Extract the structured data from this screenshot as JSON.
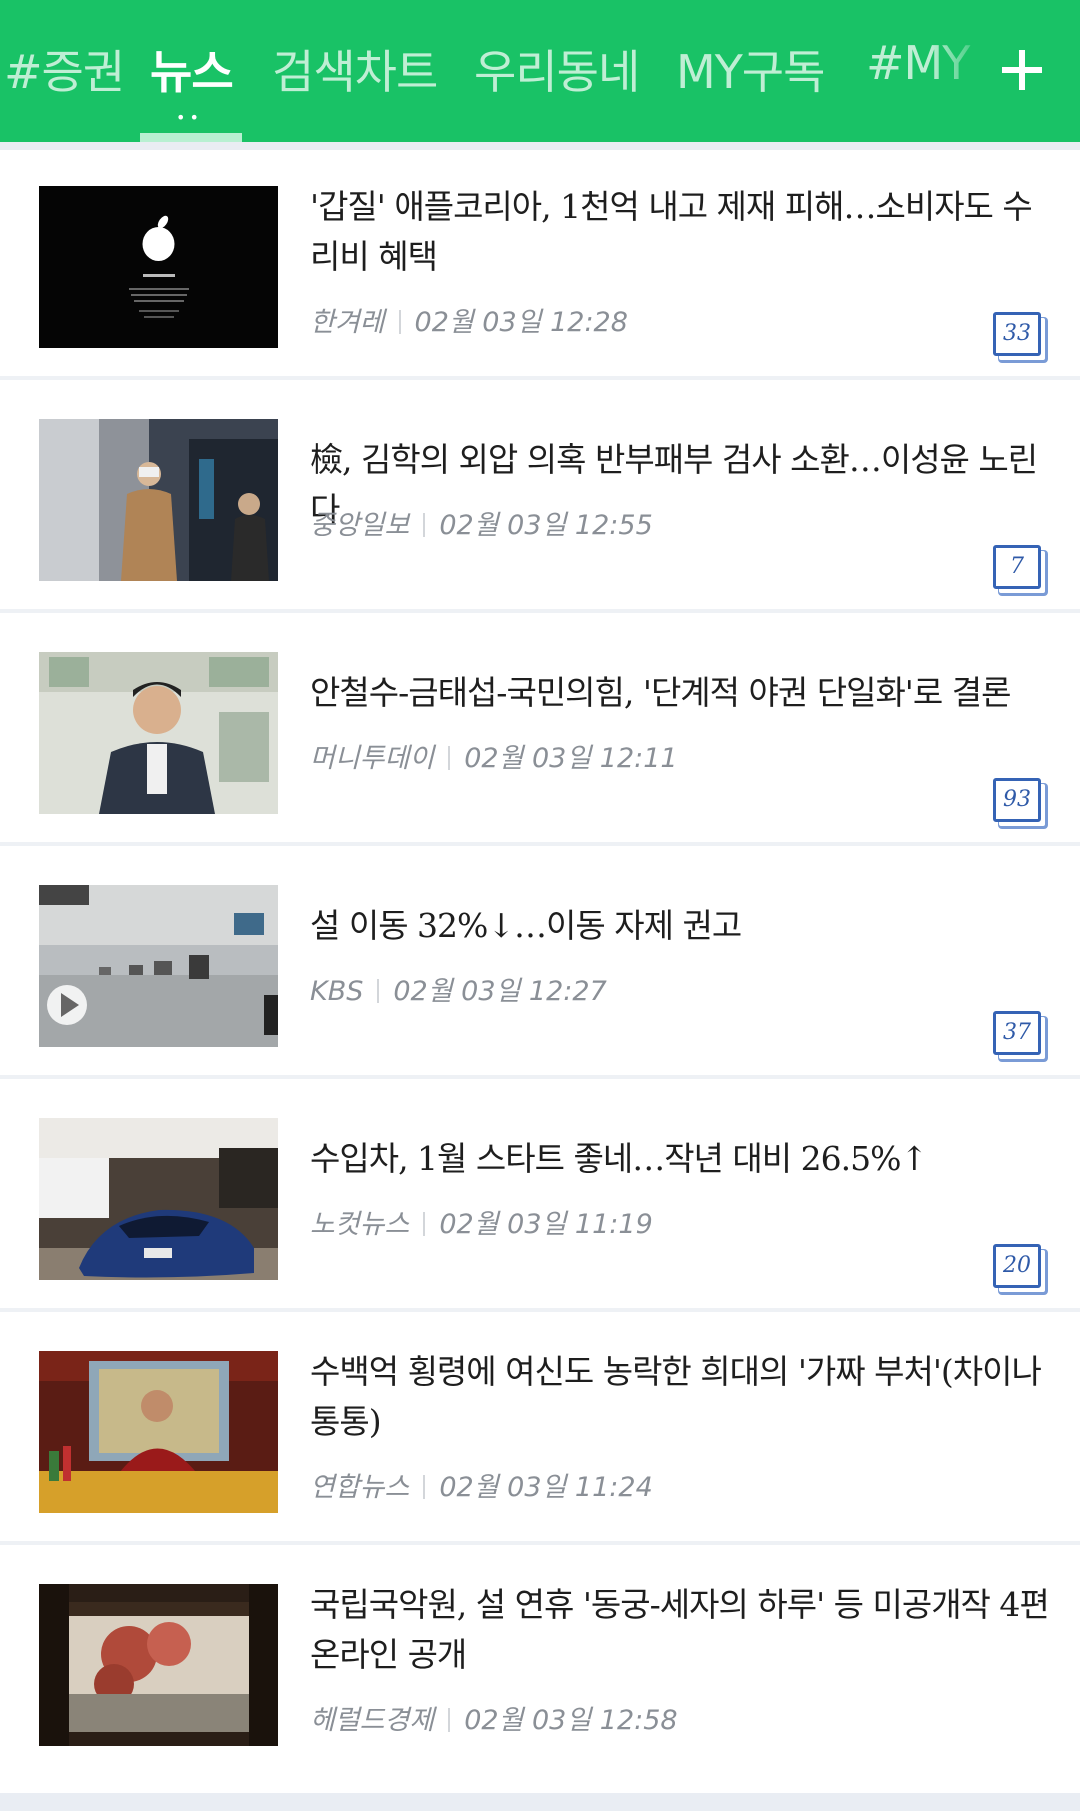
{
  "tabs": [
    {
      "label": "#증권",
      "active": false
    },
    {
      "label": "뉴스",
      "active": true
    },
    {
      "label": "검색차트",
      "active": false
    },
    {
      "label": "우리동네",
      "active": false
    },
    {
      "label": "MY구독",
      "active": false
    },
    {
      "label": "#MY",
      "active": false
    }
  ],
  "active_tab_indicator": "••",
  "add_button_icon": "plus-icon",
  "colors": {
    "brand_green": "#19c266",
    "badge_blue": "#3563b5"
  },
  "articles": [
    {
      "title": "'갑질' 애플코리아, 1천억 내고 제재 피해…소비자도 수리비 혜택",
      "source": "한겨레",
      "time": "02월 03일 12:28",
      "comments": "33",
      "thumb_caption": "It's show time."
    },
    {
      "title": "檢, 김학의 외압 의혹 반부패부 검사 소환…이성윤 노린다",
      "source": "중앙일보",
      "time": "02월 03일 12:55",
      "comments": "7"
    },
    {
      "title": "안철수-금태섭-국민의힘, '단계적 야권 단일화'로 결론",
      "source": "머니투데이",
      "time": "02월 03일 12:11",
      "comments": "93"
    },
    {
      "title": "설 이동 32%↓…이동 자제 권고",
      "source": "KBS",
      "time": "02월 03일 12:27",
      "comments": "37",
      "has_video": true
    },
    {
      "title": "수입차, 1월 스타트 좋네…작년 대비 26.5%↑",
      "source": "노컷뉴스",
      "time": "02월 03일 11:19",
      "comments": "20"
    },
    {
      "title": "수백억 횡령에 여신도 농락한 희대의 '가짜 부처'(차이나통통)",
      "source": "연합뉴스",
      "time": "02월 03일 11:24"
    },
    {
      "title": "국립국악원, 설 연휴 '동궁-세자의 하루' 등 미공개작 4편 온라인 공개",
      "source": "헤럴드경제",
      "time": "02월 03일 12:58"
    }
  ]
}
